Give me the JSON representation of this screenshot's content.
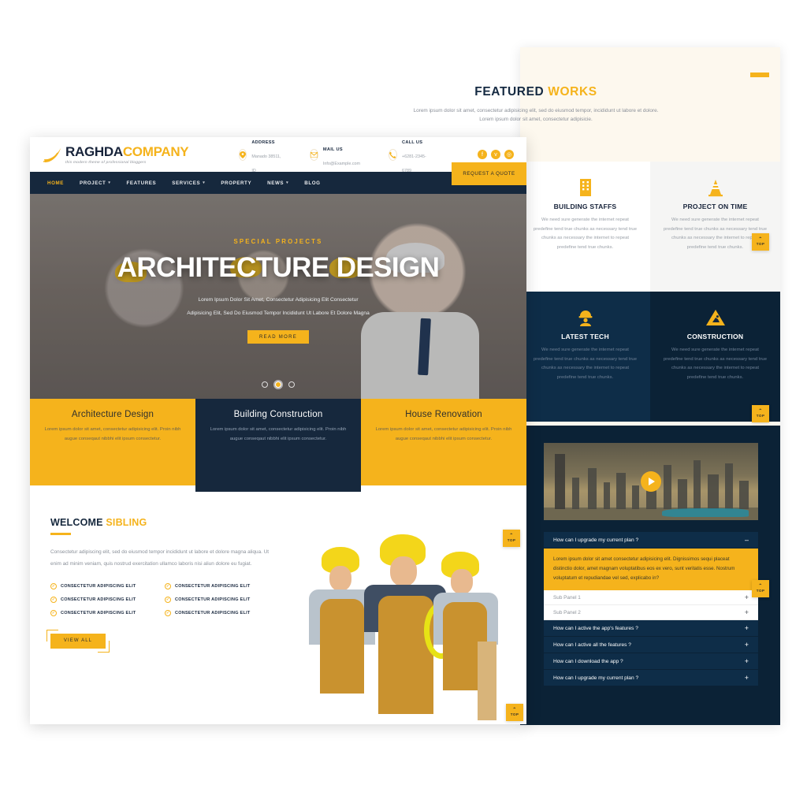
{
  "featured": {
    "title_main": "FEATURED",
    "title_accent": "WORKS",
    "subtitle": "Lorem ipsum dolor sit amet, consectetur adipisicing elit, sed do eiusmod tempor, incididunt ut labore et dolore. Lorem ipsum dolor sit amet, consectetur adipisicie."
  },
  "features": [
    {
      "icon": "building-icon",
      "title": "BUILDING STAFFS",
      "text": "We need sure generate the internet repeat predefine tend true chunks as necessary tend true chunks as necessary the internet to repeat predefine tend true chunks."
    },
    {
      "icon": "traffic-cone-icon",
      "title": "PROJECT ON TIME",
      "text": "We need sure generate the internet repeat predefine tend true chunks as necessary tend true chunks as necessary the internet to repeat predefine tend true chunks."
    },
    {
      "icon": "worker-icon",
      "title": "LATEST TECH",
      "text": "We need sure generate the internet repeat predefine tend true chunks as necessary tend true chunks as necessary the internet to repeat predefine tend true chunks."
    },
    {
      "icon": "construction-sign-icon",
      "title": "CONSTRUCTION",
      "text": "We need sure generate the internet repeat predefine tend true chunks as necessary tend true chunks as necessary the internet to repeat predefine tend true chunks."
    }
  ],
  "video": {
    "play_label": "play-button"
  },
  "faq": {
    "rows": [
      {
        "q": "How can I upgrade my current plan ?",
        "sign": "–",
        "open": true
      },
      {
        "q": "How can I active the app's features ?",
        "sign": "+",
        "open": false
      },
      {
        "q": "How can I active all the features ?",
        "sign": "+",
        "open": false
      },
      {
        "q": "How can I download the app ?",
        "sign": "+",
        "open": false
      },
      {
        "q": "How can I upgrade my current plan ?",
        "sign": "+",
        "open": false
      }
    ],
    "answer": "Lorem ipsum dolor sit amet consectetur adipisicing elit. Dignissimos sequi placeat distinctio dolor, amet magnam voluptatibus eos ex vero, sunt veritatis esse. Nostrum voluptatum et repudiandae vel sed, explicabo in?",
    "subpanels": [
      {
        "label": "Sub Panel 1",
        "sign": "+"
      },
      {
        "label": "Sub Panel 2",
        "sign": "+"
      }
    ]
  },
  "site": {
    "logo": {
      "name_main": "RAGHDA",
      "name_accent": "COMPANY",
      "tagline": "this modern theme of professional bloggers"
    },
    "contacts": [
      {
        "icon": "location-pin-icon",
        "title": "ADDRESS",
        "value": "Manado 38511, ID"
      },
      {
        "icon": "envelope-icon",
        "title": "MAIL US",
        "value": "Info@Example.com"
      },
      {
        "icon": "phone-icon",
        "title": "CALL US",
        "value": "+6281-2345-6789"
      }
    ],
    "socials": [
      {
        "icon": "facebook-icon",
        "glyph": "f"
      },
      {
        "icon": "twitter-icon",
        "glyph": "ᴠ"
      },
      {
        "icon": "instagram-icon",
        "glyph": "◎"
      }
    ],
    "nav": [
      {
        "label": "HOME",
        "caret": "",
        "active": true
      },
      {
        "label": "PROJECT",
        "caret": "▾",
        "active": false
      },
      {
        "label": "FEATURES",
        "caret": "",
        "active": false
      },
      {
        "label": "SERVICES",
        "caret": "▾",
        "active": false
      },
      {
        "label": "PROPERTY",
        "caret": "",
        "active": false
      },
      {
        "label": "NEWS",
        "caret": "▾",
        "active": false
      },
      {
        "label": "BLOG",
        "caret": "",
        "active": false
      }
    ],
    "quote_button": "REQUEST A QUOTE",
    "hero": {
      "kicker": "SPECIAL PROJECTS",
      "title": "ARCHITECTURE DESIGN",
      "line1": "Lorem Ipsum Dolor Sit Amet, Consectetur Adipisicing Elit Consectetur",
      "line2": "Adipisicing Elit, Sed Do Eiusmod Tempor Incididunt Ut Labore Et Dolore Magna",
      "cta": "READ MORE",
      "slides": 3,
      "active_slide": 2
    },
    "cards": [
      {
        "title": "Architecture Design",
        "text": "Lorem ipsum dolor sit amet, consectetur adipisicing elit. Proin nibh augue conseqaut nibbhi elit ipsum consectetur."
      },
      {
        "title": "Building Construction",
        "text": "Lorem ipsum dolor sit amet, consectetur adipisicing elit. Proin nibh augue conseqaut nibbhi elit ipsum consectetur."
      },
      {
        "title": "House Renovation",
        "text": "Lorem ipsum dolor sit amet, consectetur adipisicing elit. Proin nibh augue conseqaut nibbhi elit ipsum consectetur."
      }
    ],
    "welcome": {
      "title_main": "WELCOME",
      "title_accent": "SIBLING",
      "lead": "Consectetur adipiscing elit, sed do eiusmod tempor incididunt ut labore et dolore magna aliqua. Ut enim ad minim veniam, quis nostrud exercitation ullamco laboris nisi aliun dolore eu fugiat.",
      "checks": [
        "CONSECTETUR ADIPISCING ELIT",
        "CONSECTETUR ADIPISCING ELIT",
        "CONSECTETUR ADIPISCING ELIT",
        "CONSECTETUR ADIPISCING ELIT",
        "CONSECTETUR ADIPISCING ELIT",
        "CONSECTETUR ADIPISCING ELIT"
      ],
      "button": "VIEW ALL"
    }
  },
  "scroll_top": {
    "label": "TOP",
    "arrow": "⌃"
  },
  "colors": {
    "accent": "#f5b31c",
    "dark": "#16283d",
    "darker": "#0b2236",
    "panel_bg": "#fdf8ee"
  }
}
